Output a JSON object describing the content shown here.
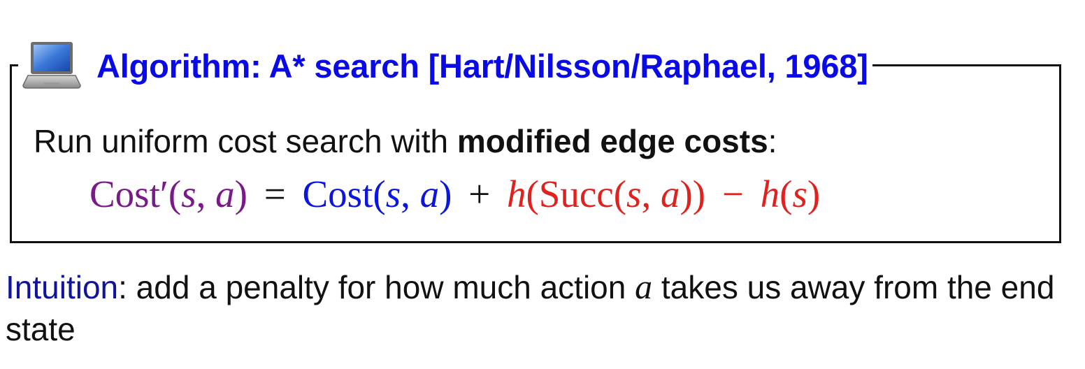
{
  "algorithm_box": {
    "icon": "laptop-icon",
    "title": "Algorithm: A* search [Hart/Nilsson/Raphael, 1968]",
    "instruction_prefix": "Run uniform cost search with ",
    "instruction_bold": "modified edge costs",
    "instruction_suffix": ":",
    "formula": {
      "lhs_func": "Cost′",
      "lhs_args_open": "(",
      "arg_s": "s",
      "comma": ", ",
      "arg_a": "a",
      "args_close": ")",
      "equals": "=",
      "cost_func": "Cost",
      "plus": "+",
      "h_func": "h",
      "succ_func": "Succ",
      "minus": "−"
    }
  },
  "intuition": {
    "label": "Intuition",
    "text_before_var": ": add a penalty for how much action ",
    "var": "a",
    "text_after_var": " takes us away from the end state"
  },
  "colors": {
    "title": "#0a0ae6",
    "lhs": "#7a1a8a",
    "cost_term": "#0a16e0",
    "heuristic_terms": "#e0221e",
    "intuition_label": "#10149a",
    "text": "#111111"
  }
}
